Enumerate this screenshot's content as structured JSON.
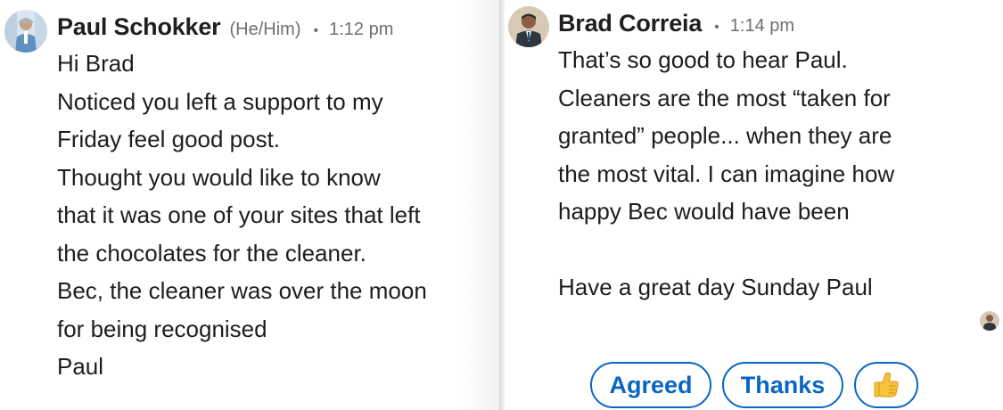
{
  "left_message": {
    "sender": "Paul Schokker",
    "pronouns": "(He/Him)",
    "separator": "•",
    "time": "1:12 pm",
    "lines": [
      "Hi Brad",
      "Noticed you left a support to my",
      "Friday feel good post.",
      "Thought you would like to know",
      "that it was one of your sites that left",
      "the chocolates for the cleaner.",
      "Bec, the cleaner was over the moon",
      "for being recognised",
      "Paul"
    ]
  },
  "right_message": {
    "sender": "Brad Correia",
    "separator": "•",
    "time": "1:14 pm",
    "lines": [
      "That’s so good to hear Paul.",
      "Cleaners are the most “taken for",
      "granted” people... when they are",
      "the most vital. I can imagine how",
      "happy Bec would have been",
      "",
      "Have a great day Sunday Paul"
    ]
  },
  "smart_replies": [
    {
      "label": "Agreed",
      "icon": ""
    },
    {
      "label": "Thanks",
      "icon": ""
    },
    {
      "label": "",
      "icon": "thumbs-up-icon"
    }
  ],
  "colors": {
    "accent": "#0a66c2",
    "text": "#1d1d1d",
    "muted": "#6f6f6f"
  }
}
